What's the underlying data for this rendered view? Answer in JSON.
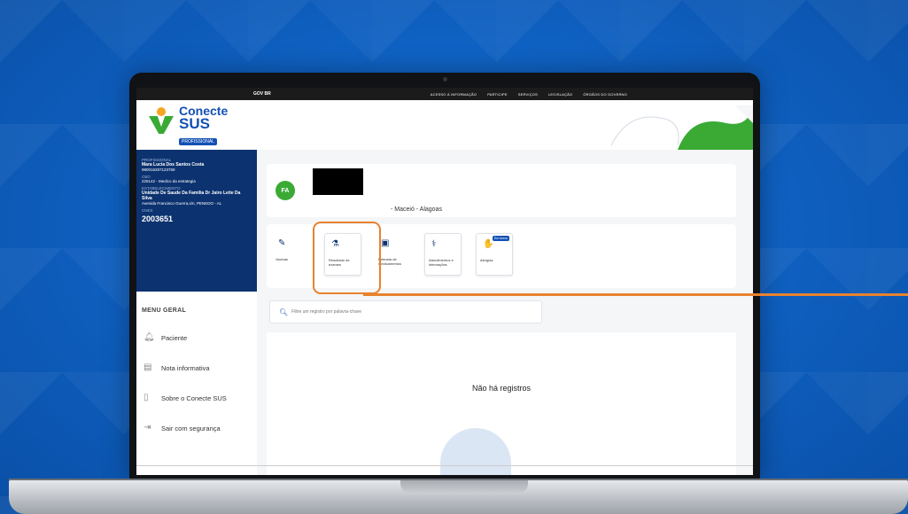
{
  "gov_bar": {
    "logo": "GOV BR",
    "links": [
      "ACESSO À INFORMAÇÃO",
      "PARTICIPE",
      "SERVIÇOS",
      "LEGISLAÇÃO",
      "ÓRGÃOS DO GOVERNO"
    ]
  },
  "brand": {
    "line1": "Conecte",
    "line2": "SUS",
    "badge": "PROFISSIONAL"
  },
  "professional": {
    "label": "PROFISSIONAL",
    "name": "Mara Lucia Dos Santos Costa",
    "id": "980016287123759",
    "cbo_label": "CBO",
    "cbo": "225142 - Medico da estrategia",
    "establishment_label": "ESTABELECIMENTO",
    "establishment": "Unidade De Saude Da Familia Dr Jairo Leite Da Silva",
    "address": "Avenida Francisco Guerra,s/n, PENEDO - AL",
    "cnes_label": "CNES",
    "cnes": "2003651"
  },
  "menu": {
    "title": "MENU GERAL",
    "items": [
      {
        "label": "Paciente",
        "icon": "bell-icon"
      },
      {
        "label": "Nota informativa",
        "icon": "document-icon"
      },
      {
        "label": "Sobre o Conecte SUS",
        "icon": "phone-icon"
      },
      {
        "label": "Sair com segurança",
        "icon": "logout-icon"
      }
    ]
  },
  "patient": {
    "initials": "FA",
    "location": "- Maceió - Alagoas"
  },
  "tiles": [
    {
      "label": "Vacinas",
      "icon": "vaccine-icon"
    },
    {
      "label": "Resultado de exames",
      "icon": "microscope-icon"
    },
    {
      "label": "Retirada de medicamentos",
      "icon": "medicine-icon"
    },
    {
      "label": "Atendimentos e internações",
      "icon": "stethoscope-icon"
    },
    {
      "label": "Alergias",
      "icon": "allergy-icon",
      "badge": "Em breve"
    }
  ],
  "search": {
    "placeholder": "Filtre um registro por palavra-chave"
  },
  "results": {
    "empty_message": "Não há registros"
  },
  "colors": {
    "gov_blue": "#1351b4",
    "brand_green": "#3aaa35",
    "sidebar_card": "#0c326f",
    "highlight": "#e8822f"
  }
}
